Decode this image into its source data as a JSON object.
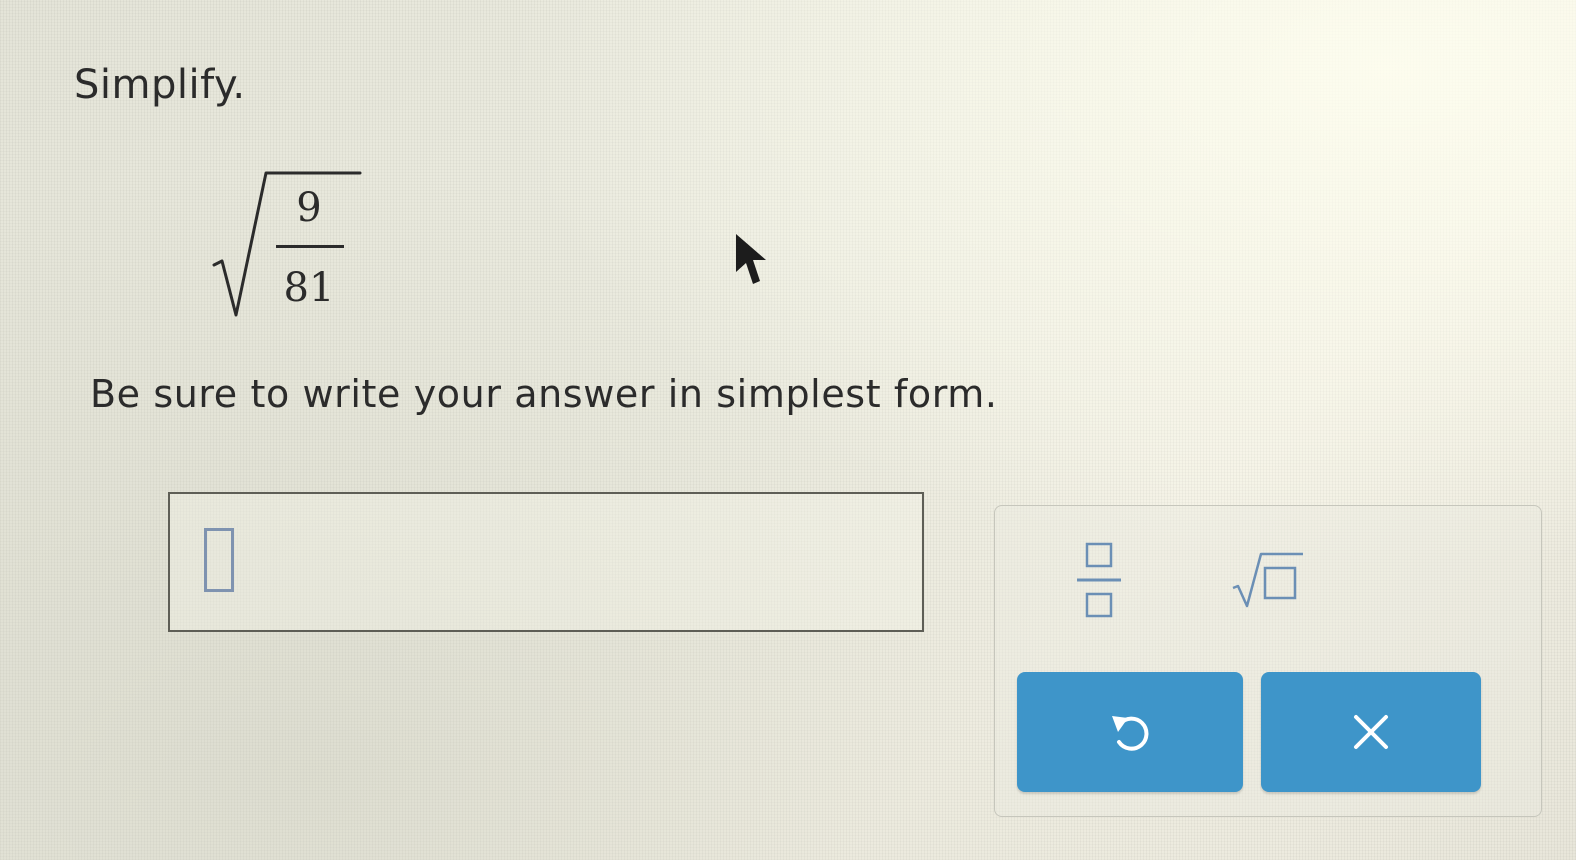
{
  "question": {
    "instruction": "Simplify.",
    "expression": {
      "numerator": "9",
      "denominator": "81"
    },
    "note": "Be sure to write your answer in simplest form."
  },
  "answer": {
    "value": ""
  },
  "keypad": {
    "keys": [
      {
        "icon": "fraction-template-icon"
      },
      {
        "icon": "square-root-template-icon"
      }
    ],
    "buttons": [
      {
        "icon": "undo-icon"
      },
      {
        "icon": "close-icon"
      }
    ],
    "button_color": "#3e95c9"
  }
}
